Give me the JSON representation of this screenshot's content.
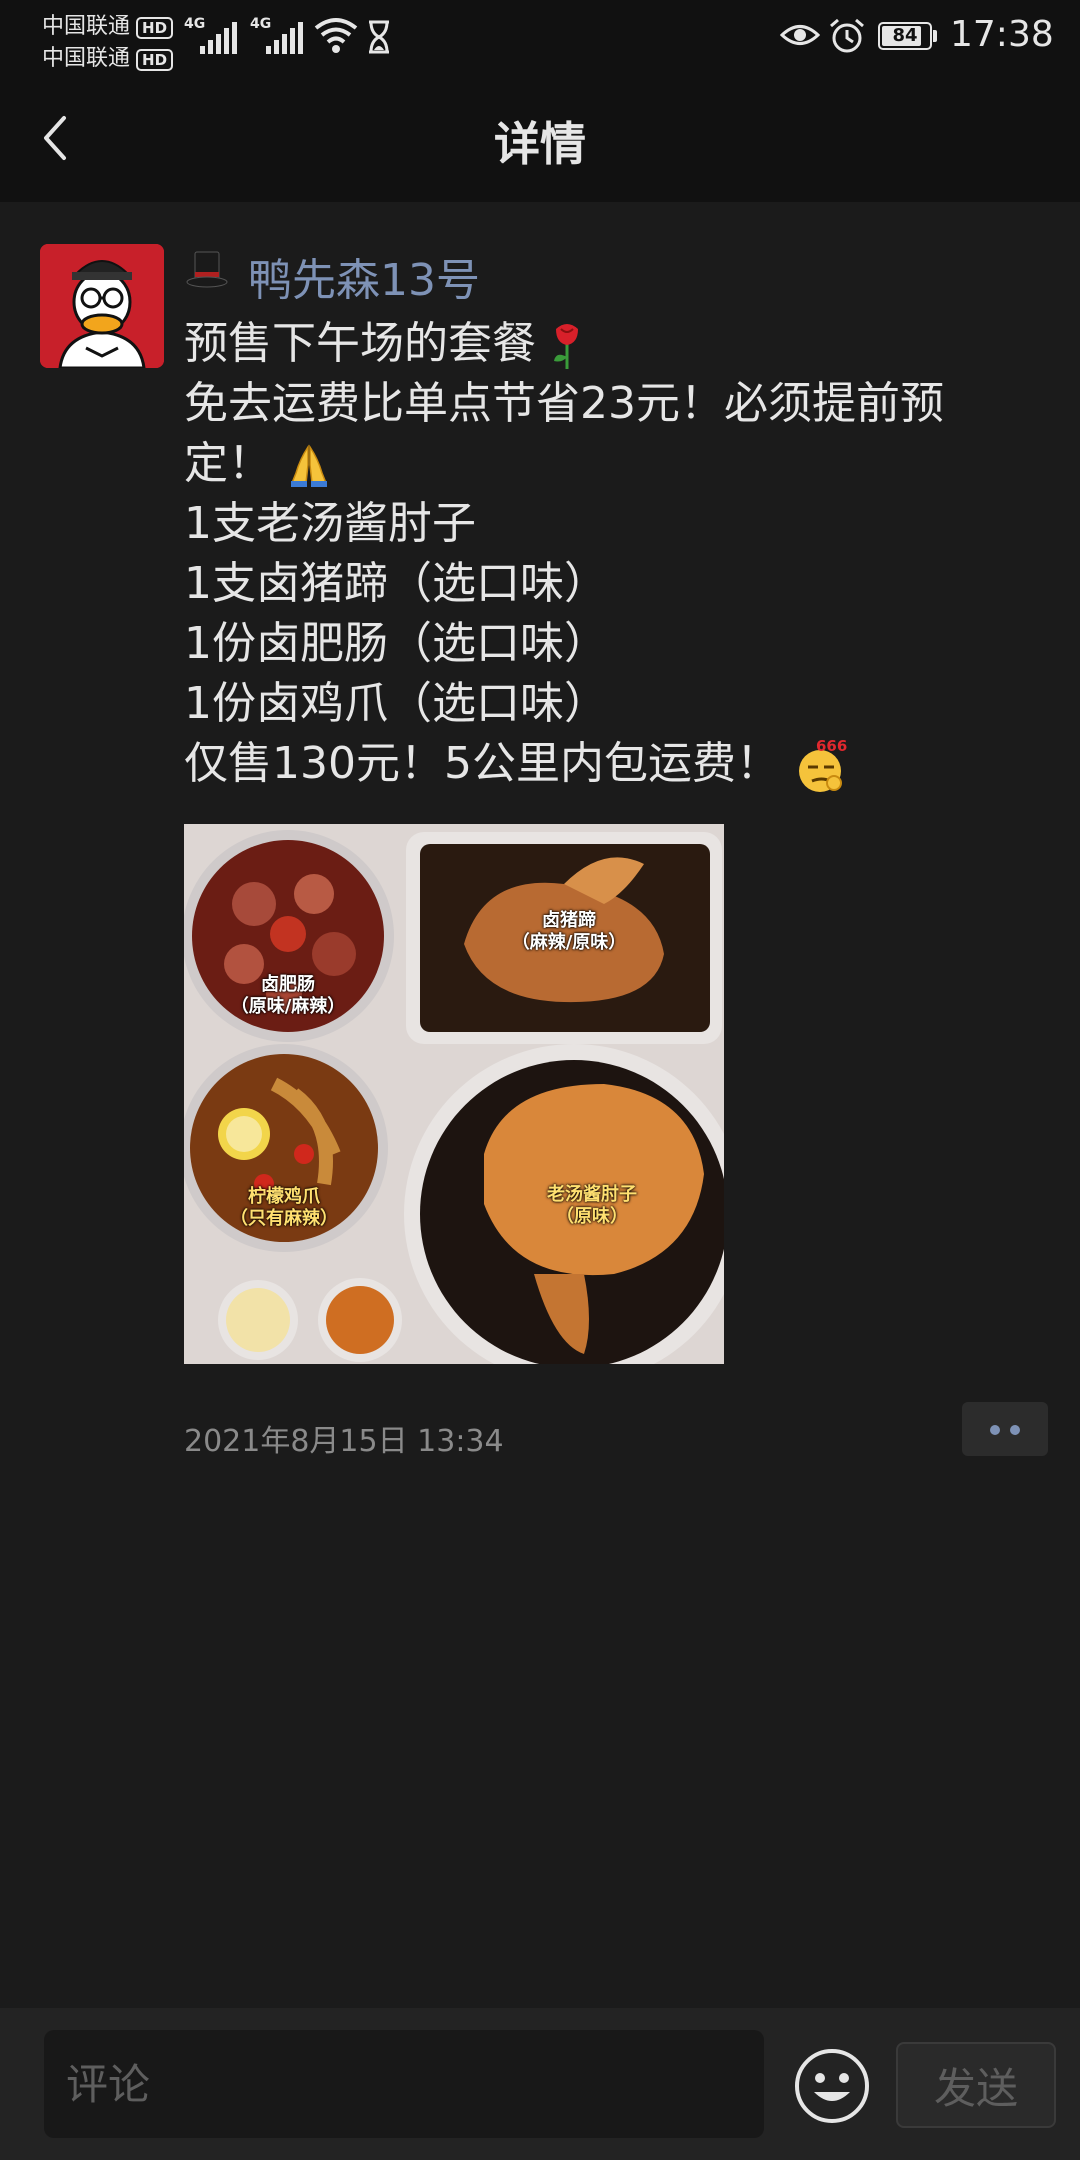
{
  "status_bar": {
    "carrier_1": "中国联通",
    "carrier_2": "中国联通",
    "hd_badge": "HD",
    "network_1": "4G",
    "network_2": "4G",
    "battery_level": "84",
    "battery_fraction": 0.84,
    "time": "17:38"
  },
  "header": {
    "title": "详情",
    "back_icon": "chevron-left-icon"
  },
  "post": {
    "username": "鸭先森13号",
    "username_icon": "top-hat-icon",
    "username_color": "#7e92b6",
    "lines": [
      "预售下午场的套餐",
      "免去运费比单点节省23元！必须提前预定！",
      "1支老汤酱肘子",
      "1支卤猪蹄（选口味）",
      "1份卤肥肠（选口味）",
      "1份卤鸡爪（选口味）",
      "仅售130元！5公里内包运费！"
    ],
    "image_labels": {
      "intestine": "卤肥肠",
      "intestine_note": "（原味/麻辣）",
      "trotter": "卤猪蹄",
      "trotter_note": "（麻辣/原味）",
      "chicken_feet": "柠檬鸡爪",
      "chicken_feet_note": "（只有麻辣）",
      "pork_knuckle": "老汤酱肘子",
      "pork_knuckle_note": "（原味）"
    },
    "emoji_sticker_text": "666",
    "timestamp": "2021年8月15日 13:34"
  },
  "comment_bar": {
    "placeholder": "评论",
    "emoji_icon": "smiley-icon",
    "send_label": "发送"
  }
}
